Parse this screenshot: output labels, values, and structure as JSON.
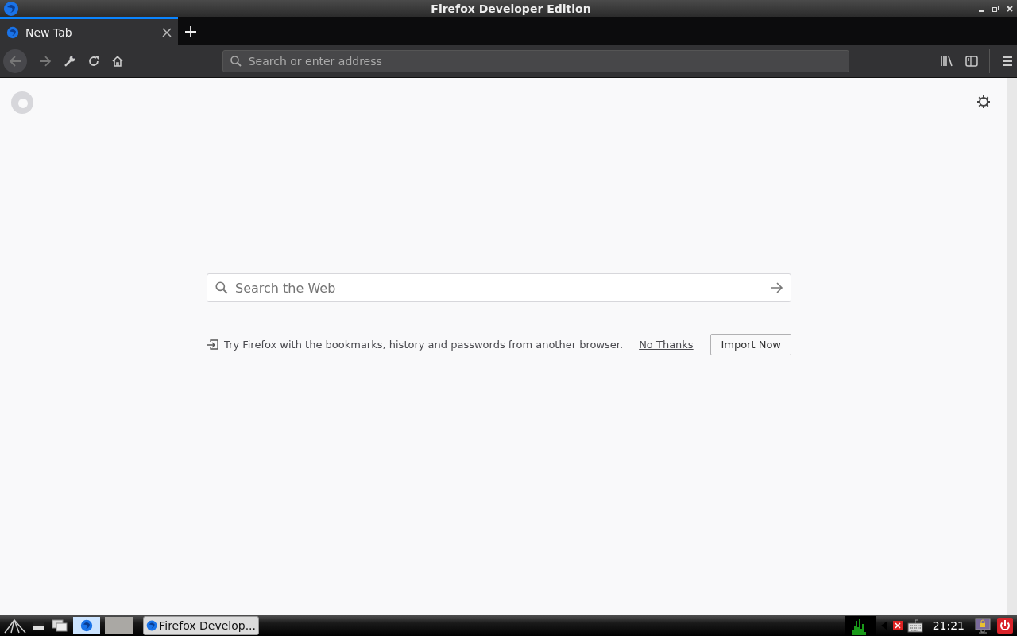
{
  "window": {
    "title": "Firefox Developer Edition"
  },
  "tabs": [
    {
      "label": "New Tab",
      "selected": true
    }
  ],
  "address_bar": {
    "placeholder": "Search or enter address"
  },
  "search": {
    "placeholder": "Search the Web"
  },
  "import_notice": {
    "text": "Try Firefox with the bookmarks, history and passwords from another browser.",
    "dismiss": "No Thanks",
    "action": "Import Now"
  },
  "taskbar": {
    "tasks": [
      {
        "label": "Firefox Develop...",
        "selected": false
      }
    ],
    "clock": "21:21"
  }
}
